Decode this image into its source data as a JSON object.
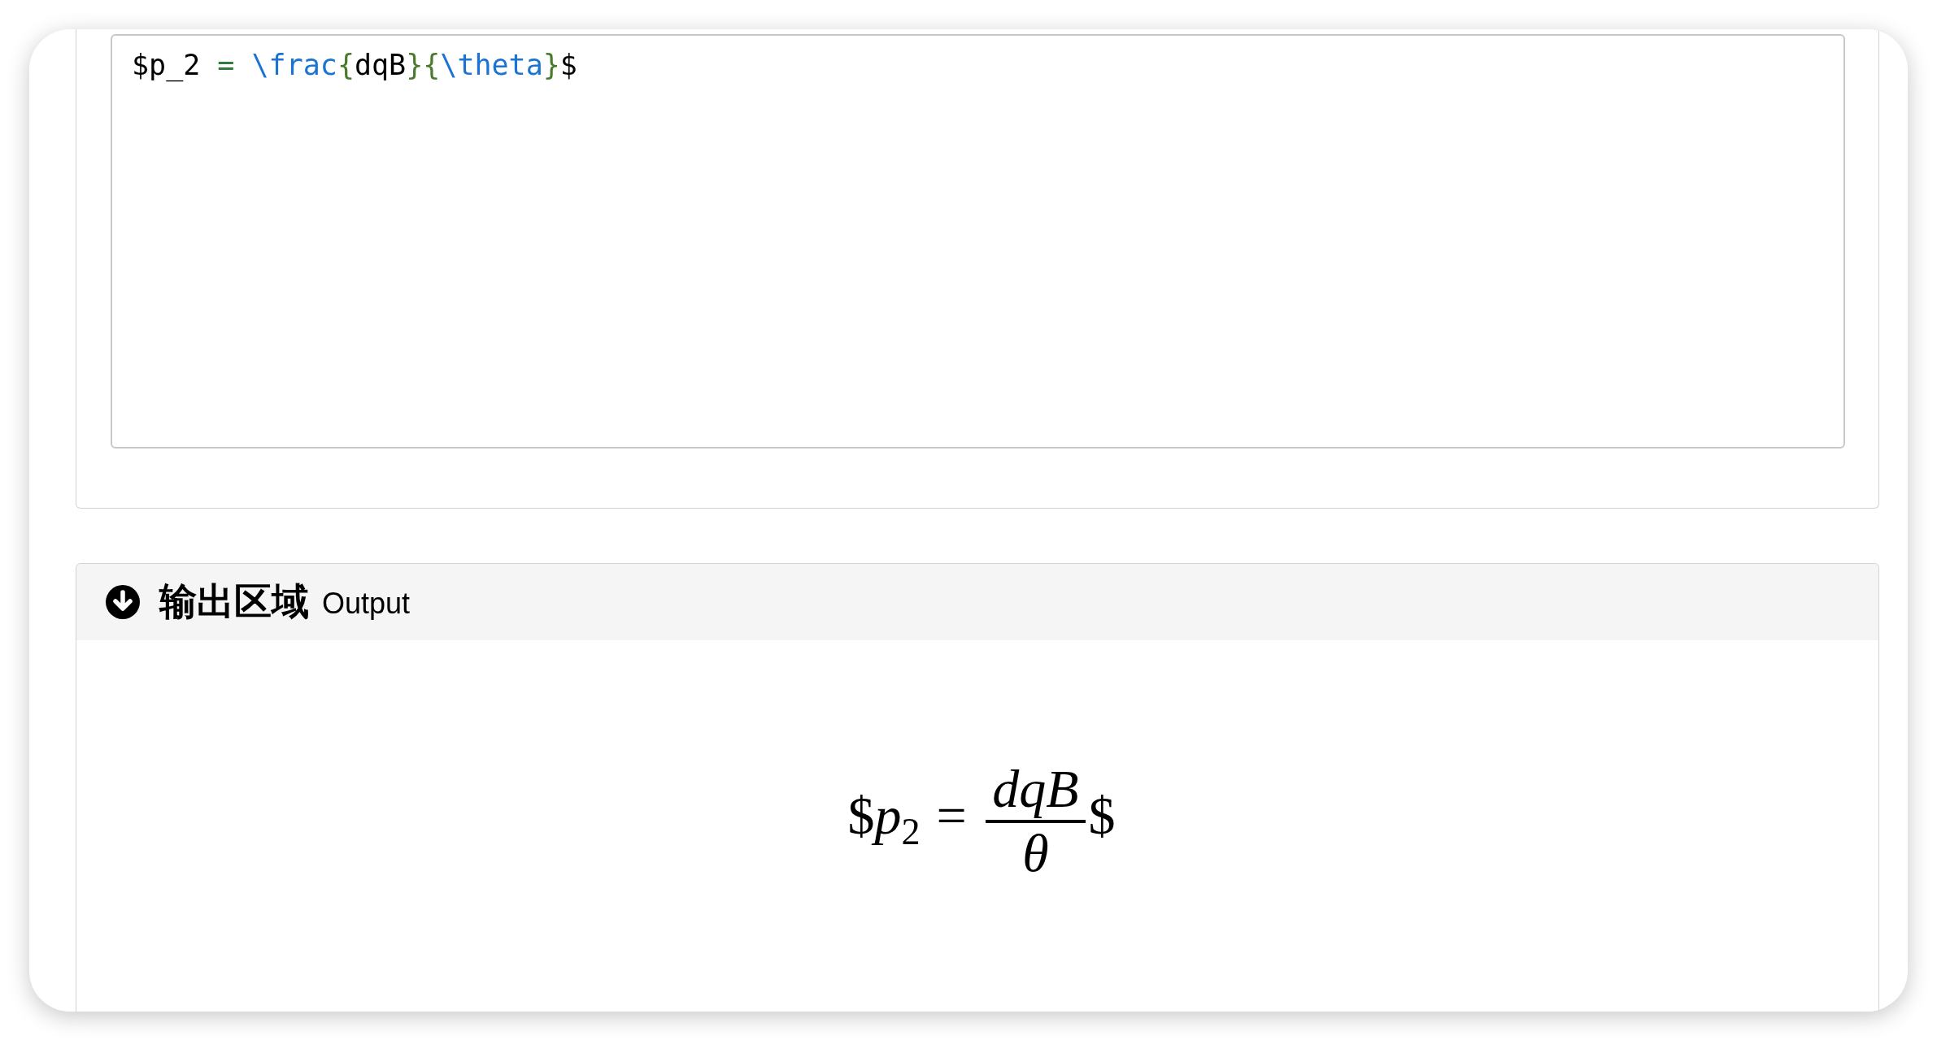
{
  "input_panel": {
    "editor": {
      "code": [
        {
          "text": "$p_2 ",
          "kind": "plain"
        },
        {
          "text": "=",
          "kind": "operator"
        },
        {
          "text": " \\frac",
          "kind": "keyword"
        },
        {
          "text": "{",
          "kind": "bracket"
        },
        {
          "text": "dqB",
          "kind": "plain"
        },
        {
          "text": "}",
          "kind": "bracket"
        },
        {
          "text": "{",
          "kind": "bracket"
        },
        {
          "text": "\\theta",
          "kind": "keyword"
        },
        {
          "text": "}",
          "kind": "bracket"
        },
        {
          "text": "$",
          "kind": "plain"
        }
      ]
    }
  },
  "output_panel": {
    "title": "输出区域",
    "subtitle": "Output",
    "formula": {
      "open": "$",
      "base": "p",
      "subscript": "2",
      "relation": "=",
      "numerator": "dqB",
      "denominator": "θ",
      "close": "$"
    }
  }
}
